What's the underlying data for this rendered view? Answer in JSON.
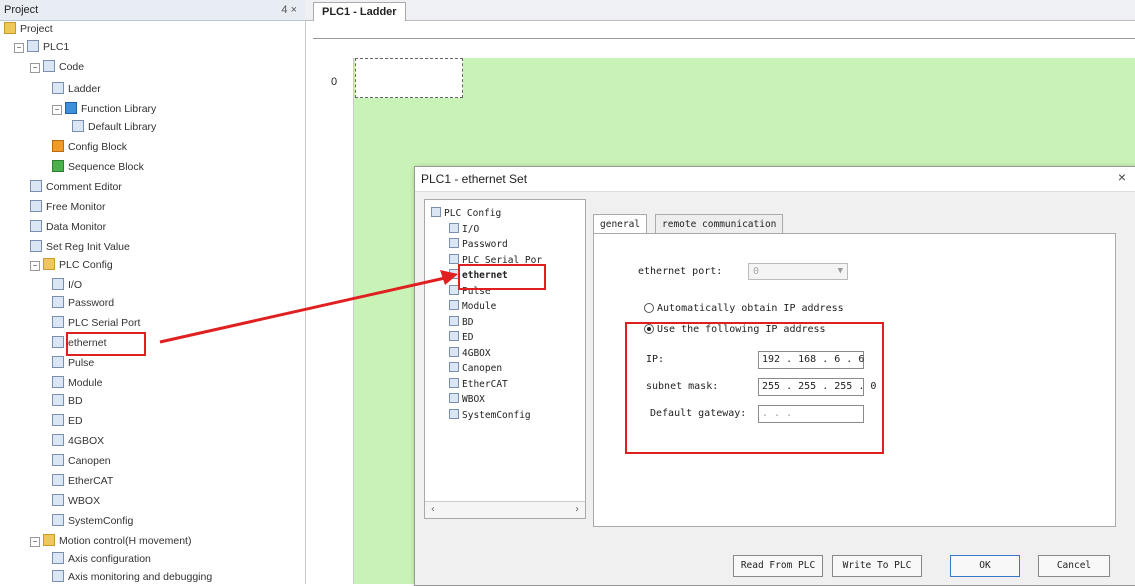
{
  "project": {
    "title": "Project",
    "controls": "4 ×",
    "items": [
      {
        "label": "Project"
      },
      {
        "label": "PLC1"
      },
      {
        "label": "Code"
      },
      {
        "label": "Ladder"
      },
      {
        "label": "Function Library"
      },
      {
        "label": "Default Library"
      },
      {
        "label": "Config Block"
      },
      {
        "label": "Sequence Block"
      },
      {
        "label": "Comment Editor"
      },
      {
        "label": "Free Monitor"
      },
      {
        "label": "Data Monitor"
      },
      {
        "label": "Set Reg Init Value"
      },
      {
        "label": "PLC Config"
      },
      {
        "label": "I/O"
      },
      {
        "label": "Password"
      },
      {
        "label": "PLC Serial Port"
      },
      {
        "label": "ethernet"
      },
      {
        "label": "Pulse"
      },
      {
        "label": "Module"
      },
      {
        "label": "BD"
      },
      {
        "label": "ED"
      },
      {
        "label": "4GBOX"
      },
      {
        "label": "Canopen"
      },
      {
        "label": "EtherCAT"
      },
      {
        "label": "WBOX"
      },
      {
        "label": "SystemConfig"
      },
      {
        "label": "Motion control(H movement)"
      },
      {
        "label": "Axis configuration"
      },
      {
        "label": "Axis monitoring and debugging"
      }
    ]
  },
  "editor": {
    "tab": "PLC1 - Ladder",
    "rung_number": "0"
  },
  "dialog": {
    "title": "PLC1 - ethernet Set",
    "close": "×",
    "tree": [
      {
        "label": "PLC Config"
      },
      {
        "label": "I/O"
      },
      {
        "label": "Password"
      },
      {
        "label": "PLC Serial Por"
      },
      {
        "label": "ethernet"
      },
      {
        "label": "Pulse"
      },
      {
        "label": "Module"
      },
      {
        "label": "BD"
      },
      {
        "label": "ED"
      },
      {
        "label": "4GBOX"
      },
      {
        "label": "Canopen"
      },
      {
        "label": "EtherCAT"
      },
      {
        "label": "WBOX"
      },
      {
        "label": "SystemConfig"
      }
    ],
    "tabs": {
      "general": "general",
      "remote": "remote communication"
    },
    "ethernet_port_label": "ethernet port:",
    "ethernet_port_value": "0",
    "radio_auto": "Automatically obtain IP address",
    "radio_manual": "Use the following IP address",
    "ip_label": "IP:",
    "ip_value": "192 . 168 .  6  .  6",
    "mask_label": "subnet mask:",
    "mask_value": "255 . 255 . 255 .  0",
    "gateway_label": "Default gateway:",
    "gateway_value": "  .    .    .",
    "buttons": {
      "read": "Read From PLC",
      "write": "Write To PLC",
      "ok": "OK",
      "cancel": "Cancel"
    }
  },
  "colors": {
    "highlight": "#e02020",
    "ladder_bg": "#c9f2b6"
  }
}
